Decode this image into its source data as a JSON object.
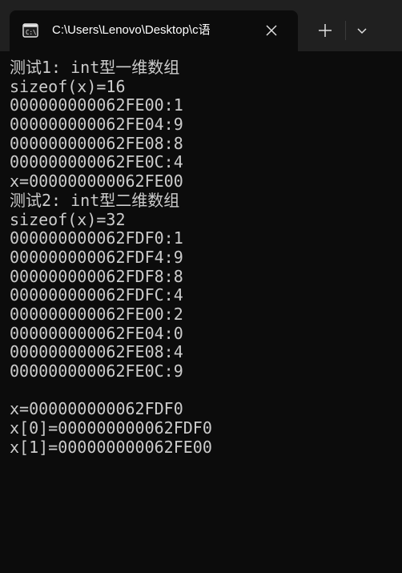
{
  "window": {
    "tab_title": "C:\\Users\\Lenovo\\Desktop\\c语",
    "tab_icon": "terminal-icon",
    "close_icon": "close-icon",
    "new_tab_icon": "plus-icon",
    "dropdown_icon": "chevron-down-icon"
  },
  "console": {
    "lines": [
      "测试1: int型一维数组",
      "sizeof(x)=16",
      "000000000062FE00:1",
      "000000000062FE04:9",
      "000000000062FE08:8",
      "000000000062FE0C:4",
      "x=000000000062FE00",
      "测试2: int型二维数组",
      "sizeof(x)=32",
      "000000000062FDF0:1",
      "000000000062FDF4:9",
      "000000000062FDF8:8",
      "000000000062FDFC:4",
      "000000000062FE00:2",
      "000000000062FE04:0",
      "000000000062FE08:4",
      "000000000062FE0C:9",
      "",
      "x=000000000062FDF0",
      "x[0]=000000000062FDF0",
      "x[1]=000000000062FE00"
    ]
  }
}
